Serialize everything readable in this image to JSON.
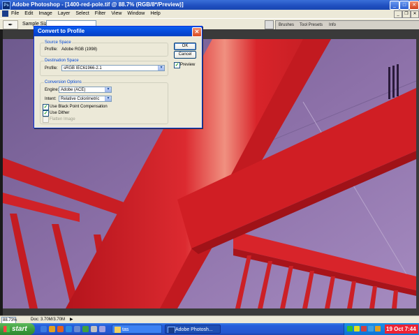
{
  "window": {
    "title": "Adobe Photoshop - [1400-red-pole.tif @ 88.7% (RGB/8*/Preview)]",
    "app_icon_text": "Ps",
    "minimize": "_",
    "maximize": "□",
    "close": "✕"
  },
  "menubar": {
    "items": [
      "File",
      "Edit",
      "Image",
      "Layer",
      "Select",
      "Filter",
      "View",
      "Window",
      "Help"
    ],
    "doc_minimize": "_",
    "doc_restore": "❐",
    "doc_close": "✕"
  },
  "options_bar": {
    "tool_icon": "eyedropper-icon",
    "tool_glyph": "✒",
    "sample_size_label": "Sample Size:",
    "palette_tabs": [
      "Brushes",
      "Tool Presets",
      "Info"
    ]
  },
  "dialog": {
    "title": "Convert to Profile",
    "close_glyph": "✕",
    "source_space": {
      "label": "Source Space",
      "profile_label": "Profile:",
      "profile_value": "Adobe RGB (1998)"
    },
    "destination_space": {
      "label": "Destination Space",
      "profile_label": "Profile:",
      "profile_value": "sRGB IEC61966-2.1"
    },
    "conversion_options": {
      "label": "Conversion Options",
      "engine_label": "Engine:",
      "engine_value": "Adobe (ACE)",
      "intent_label": "Intent:",
      "intent_value": "Relative Colorimetric",
      "black_point_label": "Use Black Point Compensation",
      "black_point_checked": true,
      "dither_label": "Use Dither",
      "dither_checked": true,
      "flatten_label": "Flatten Image",
      "flatten_checked": false,
      "flatten_disabled": true
    },
    "ok_label": "OK",
    "cancel_label": "Cancel",
    "preview_label": "Preview",
    "preview_checked": true,
    "check_glyph": "✓",
    "dropdown_glyph": "▾"
  },
  "statusbar": {
    "zoom": "88.73%",
    "doc_info": "Doc: 3.70M/3.70M",
    "arrow": "▶"
  },
  "taskbar": {
    "start_label": "start",
    "tasks": [
      {
        "label": "tas"
      },
      {
        "label": "Adobe Photosh..."
      }
    ],
    "clock": "19 Oct 7:44"
  },
  "colors": {
    "pole_red": "#d8242a",
    "wall_purple": "#8a6a9a",
    "xp_blue": "#245edb"
  }
}
